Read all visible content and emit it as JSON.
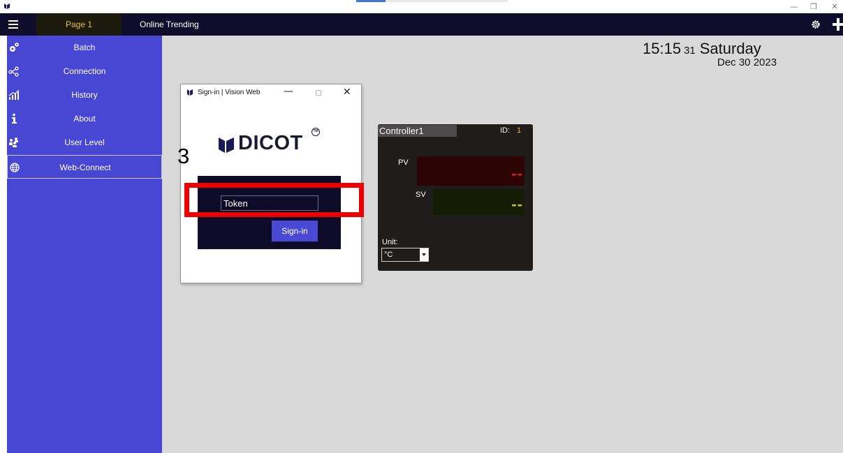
{
  "window": {
    "minimize_glyph": "—",
    "restore_glyph": "❐",
    "close_glyph": "✕"
  },
  "topbar": {
    "tabs": [
      {
        "label": "Page 1",
        "active": true
      },
      {
        "label": "Online Trending",
        "active": false
      }
    ],
    "icons": [
      "menu-icon",
      "settings-icon",
      "plus-icon"
    ]
  },
  "sidebar": {
    "items": [
      {
        "label": "Batch",
        "icon": "gears-icon"
      },
      {
        "label": "Connection",
        "icon": "connection-icon"
      },
      {
        "label": "History",
        "icon": "history-chart-icon"
      },
      {
        "label": "About",
        "icon": "info-icon"
      },
      {
        "label": "User Level",
        "icon": "users-icon"
      },
      {
        "label": "Web-Connect",
        "icon": "globe-icon",
        "active": true
      }
    ]
  },
  "clock": {
    "time": "15:15",
    "seconds": "31",
    "day": "Saturday",
    "date": "Dec 30 2023"
  },
  "dialog": {
    "title": "Sign-in | Vision Web",
    "logo_text": "DICOT",
    "logo_tm": "TM",
    "token": {
      "value": "Token"
    },
    "signin_label": "Sign-in"
  },
  "annotation": {
    "step": "3",
    "highlight_color": "#ee0000"
  },
  "controller": {
    "name": "Controller1",
    "id_label": "ID:",
    "id_value": "1",
    "pv_label": "PV",
    "pv_value": "--",
    "sv_label": "SV",
    "sv_value": "--",
    "unit_label": "Unit:",
    "unit_value": "°C"
  },
  "colors": {
    "sidebar": "#4747d4",
    "topbar": "#0f0d2b",
    "active_tab_text": "#e3c22b",
    "pv_color": "#e02020",
    "sv_color": "#c7c21f",
    "signin_button": "#4949d4"
  }
}
